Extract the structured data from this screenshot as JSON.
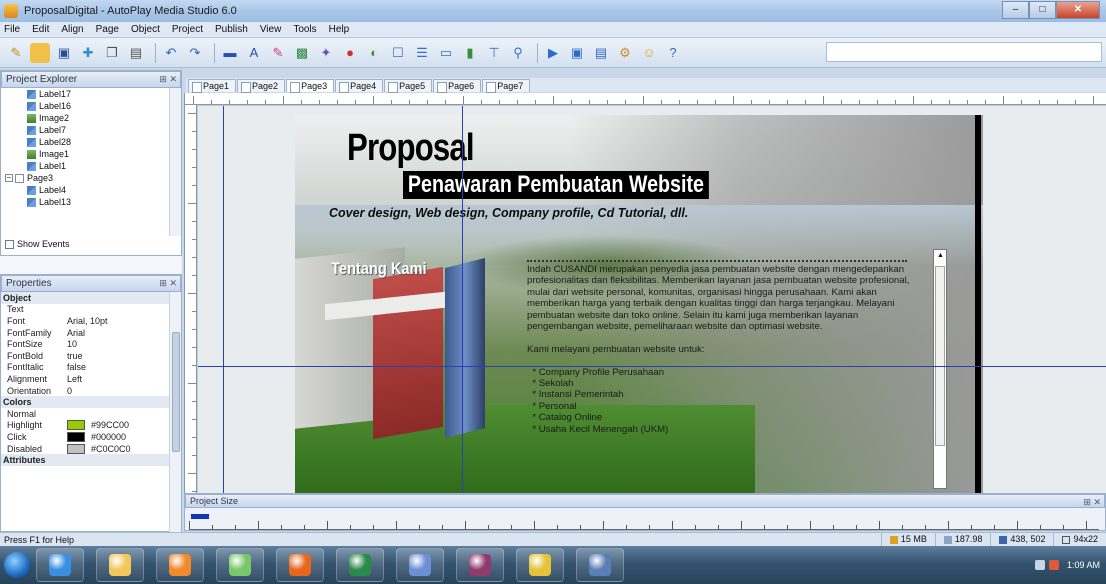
{
  "window": {
    "title": "ProposalDigital - AutoPlay Media Studio 6.0",
    "minimize": "–",
    "maximize": "□",
    "close": "✕"
  },
  "menu": [
    "File",
    "Edit",
    "Align",
    "Page",
    "Object",
    "Project",
    "Publish",
    "View",
    "Tools",
    "Help"
  ],
  "explorer": {
    "title": "Project Explorer",
    "items": [
      {
        "label": "Label17",
        "kind": "label",
        "indent": 2
      },
      {
        "label": "Label16",
        "kind": "label",
        "indent": 2
      },
      {
        "label": "Image2",
        "kind": "image",
        "indent": 2
      },
      {
        "label": "Label7",
        "kind": "label",
        "indent": 2
      },
      {
        "label": "Label28",
        "kind": "label",
        "indent": 2
      },
      {
        "label": "Image1",
        "kind": "image",
        "indent": 2
      },
      {
        "label": "Label1",
        "kind": "label",
        "indent": 2
      },
      {
        "label": "Page3",
        "kind": "page",
        "indent": 1
      },
      {
        "label": "Label4",
        "kind": "label",
        "indent": 2
      },
      {
        "label": "Label13",
        "kind": "label",
        "indent": 2
      }
    ],
    "show_events": "Show Events"
  },
  "properties": {
    "title": "Properties",
    "rows": [
      {
        "cat": "Object"
      },
      {
        "k": "Text",
        "v": ""
      },
      {
        "k": "Font",
        "v": "Arial, 10pt"
      },
      {
        "k": "FontFamily",
        "v": "Arial"
      },
      {
        "k": "FontSize",
        "v": "10"
      },
      {
        "k": "FontBold",
        "v": "true"
      },
      {
        "k": "FontItalic",
        "v": "false"
      },
      {
        "k": "Alignment",
        "v": "Left"
      },
      {
        "k": "Orientation",
        "v": "0"
      },
      {
        "cat": "Colors"
      },
      {
        "k": "Normal",
        "v": ""
      },
      {
        "k": "Highlight",
        "v": "#99CC00",
        "swatch": "#99CC00"
      },
      {
        "k": "Click",
        "v": "#000000",
        "swatch": "#000000"
      },
      {
        "k": "Disabled",
        "v": "#C0C0C0",
        "swatch": "#C0C0C0"
      },
      {
        "cat": "Attributes"
      }
    ]
  },
  "tabs": [
    "Page1",
    "Page2",
    "Page3",
    "Page4",
    "Page5",
    "Page6",
    "Page7"
  ],
  "active_tab": "Page3",
  "slide": {
    "title": "Proposal",
    "subtitle": "Penawaran Pembuatan Website",
    "tagline": "Cover design, Web design, Company profile, Cd Tutorial, dll.",
    "heading": "Tentang Kami",
    "body": "Indah CUSANDI merupakan penyedia jasa pembuatan website dengan mengedepankan profesionalitas dan fleksibilitas. Memberikan layanan jasa pembuatan website profesional, mulai dari website personal, komunitas, organisasi hingga perusahaan. Kami akan memberikan harga yang terbaik dengan kualitas tinggi dan harga terjangkau. Melayani pembuatan website dan toko online. Selain itu kami juga memberikan layanan pengembangan website, pemeliharaan website dan optimasi website.\n\nKami melayani pembuatan website untuk:\n\n  * Company Profile Perusahaan\n  * Sekolah\n  * Instansi Pemerintah\n  * Personal\n  * Catalog Online\n  * Usaha Kecil Menengah (UKM)"
  },
  "project_size": {
    "title": "Project Size"
  },
  "status": {
    "help": "Press F1 for Help",
    "size": "15 MB",
    "disk": "187.98",
    "position": "438, 502",
    "dims": "94x22"
  },
  "taskbar": {
    "apps": [
      {
        "name": "internet-explorer",
        "color": "#3b8fe0"
      },
      {
        "name": "file-explorer",
        "color": "#f2c85a"
      },
      {
        "name": "media-player",
        "color": "#f08a2a"
      },
      {
        "name": "messenger",
        "color": "#78c86a"
      },
      {
        "name": "firefox",
        "color": "#e6671d"
      },
      {
        "name": "corel-draw",
        "color": "#2a8a4a"
      },
      {
        "name": "autoplay",
        "color": "#6c8fd6"
      },
      {
        "name": "winrar",
        "color": "#8e3b6e"
      },
      {
        "name": "chrome",
        "color": "#e4c33b"
      },
      {
        "name": "document",
        "color": "#5a7fb8"
      }
    ],
    "clock": "1:09 AM"
  }
}
